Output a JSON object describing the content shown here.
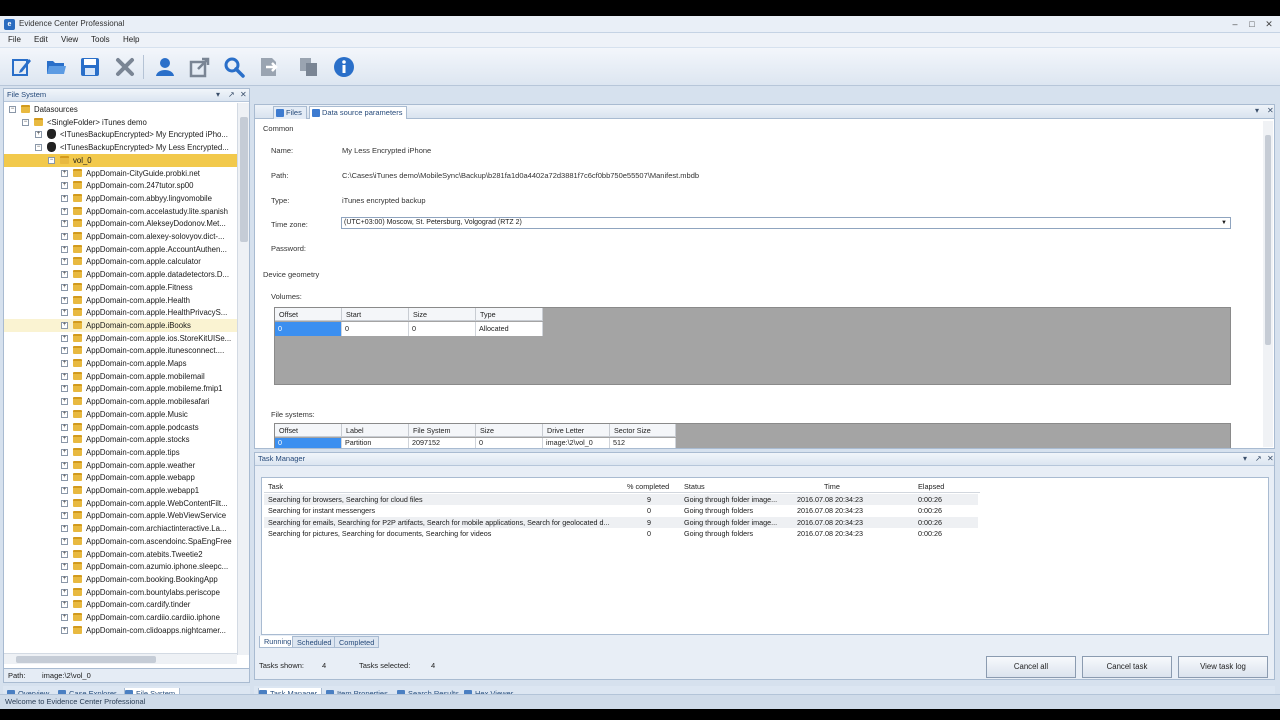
{
  "window": {
    "title": "Evidence Center Professional",
    "icon_letter": "e"
  },
  "menu": [
    "File",
    "Edit",
    "View",
    "Tools",
    "Help"
  ],
  "toolbar": [
    {
      "name": "edit-icon",
      "color": "#2a6fc9"
    },
    {
      "name": "open-folder-icon",
      "color": "#2a6fc9"
    },
    {
      "name": "save-icon",
      "color": "#2a6fc9"
    },
    {
      "name": "close-icon",
      "color": "#7a8594"
    },
    {
      "name": "user-icon",
      "color": "#2a6fc9"
    },
    {
      "name": "export-icon",
      "color": "#7a8594"
    },
    {
      "name": "search-icon",
      "color": "#2a6fc9"
    },
    {
      "name": "import-icon",
      "color": "#7a8594"
    },
    {
      "name": "copy-icon",
      "color": "#7a8594"
    },
    {
      "name": "info-icon",
      "color": "#2a6fc9"
    }
  ],
  "left_panel": {
    "title": "File System",
    "tree": [
      {
        "label": "Datasources",
        "indent": 0,
        "icon": "folder",
        "exp": "-"
      },
      {
        "label": "<SingleFolder> iTunes demo",
        "indent": 1,
        "icon": "folder",
        "exp": "-"
      },
      {
        "label": "<ITunesBackupEncrypted> My Encrypted iPho...",
        "indent": 2,
        "icon": "apple",
        "exp": "+"
      },
      {
        "label": "<ITunesBackupEncrypted> My Less Encrypted...",
        "indent": 2,
        "icon": "apple",
        "exp": "-"
      },
      {
        "label": "vol_0",
        "indent": 3,
        "icon": "folder",
        "exp": "-",
        "selected": true
      },
      {
        "label": "AppDomain-CityGuide.probki.net",
        "indent": 4,
        "icon": "folder",
        "exp": "+"
      },
      {
        "label": "AppDomain-com.247tutor.sp00",
        "indent": 4,
        "icon": "folder",
        "exp": "+"
      },
      {
        "label": "AppDomain-com.abbyy.lingvomobile",
        "indent": 4,
        "icon": "folder",
        "exp": "+"
      },
      {
        "label": "AppDomain-com.accelastudy.lite.spanish",
        "indent": 4,
        "icon": "folder",
        "exp": "+"
      },
      {
        "label": "AppDomain-com.AlekseyDodonov.Met...",
        "indent": 4,
        "icon": "folder",
        "exp": "+"
      },
      {
        "label": "AppDomain-com.alexey-solovyov.dict-...",
        "indent": 4,
        "icon": "folder",
        "exp": "+"
      },
      {
        "label": "AppDomain-com.apple.AccountAuthen...",
        "indent": 4,
        "icon": "folder",
        "exp": "+"
      },
      {
        "label": "AppDomain-com.apple.calculator",
        "indent": 4,
        "icon": "folder",
        "exp": "+"
      },
      {
        "label": "AppDomain-com.apple.datadetectors.D...",
        "indent": 4,
        "icon": "folder",
        "exp": "+"
      },
      {
        "label": "AppDomain-com.apple.Fitness",
        "indent": 4,
        "icon": "folder",
        "exp": "+"
      },
      {
        "label": "AppDomain-com.apple.Health",
        "indent": 4,
        "icon": "folder",
        "exp": "+"
      },
      {
        "label": "AppDomain-com.apple.HealthPrivacyS...",
        "indent": 4,
        "icon": "folder",
        "exp": "+"
      },
      {
        "label": "AppDomain-com.apple.iBooks",
        "indent": 4,
        "icon": "folder",
        "exp": "+",
        "hover": true
      },
      {
        "label": "AppDomain-com.apple.ios.StoreKitUISe...",
        "indent": 4,
        "icon": "folder",
        "exp": "+"
      },
      {
        "label": "AppDomain-com.apple.itunesconnect....",
        "indent": 4,
        "icon": "folder",
        "exp": "+"
      },
      {
        "label": "AppDomain-com.apple.Maps",
        "indent": 4,
        "icon": "folder",
        "exp": "+"
      },
      {
        "label": "AppDomain-com.apple.mobilemail",
        "indent": 4,
        "icon": "folder",
        "exp": "+"
      },
      {
        "label": "AppDomain-com.apple.mobileme.fmip1",
        "indent": 4,
        "icon": "folder",
        "exp": "+"
      },
      {
        "label": "AppDomain-com.apple.mobilesafari",
        "indent": 4,
        "icon": "folder",
        "exp": "+"
      },
      {
        "label": "AppDomain-com.apple.Music",
        "indent": 4,
        "icon": "folder",
        "exp": "+"
      },
      {
        "label": "AppDomain-com.apple.podcasts",
        "indent": 4,
        "icon": "folder",
        "exp": "+"
      },
      {
        "label": "AppDomain-com.apple.stocks",
        "indent": 4,
        "icon": "folder",
        "exp": "+"
      },
      {
        "label": "AppDomain-com.apple.tips",
        "indent": 4,
        "icon": "folder",
        "exp": "+"
      },
      {
        "label": "AppDomain-com.apple.weather",
        "indent": 4,
        "icon": "folder",
        "exp": "+"
      },
      {
        "label": "AppDomain-com.apple.webapp",
        "indent": 4,
        "icon": "folder",
        "exp": "+"
      },
      {
        "label": "AppDomain-com.apple.webapp1",
        "indent": 4,
        "icon": "folder",
        "exp": "+"
      },
      {
        "label": "AppDomain-com.apple.WebContentFilt...",
        "indent": 4,
        "icon": "folder",
        "exp": "+"
      },
      {
        "label": "AppDomain-com.apple.WebViewService",
        "indent": 4,
        "icon": "folder",
        "exp": "+"
      },
      {
        "label": "AppDomain-com.archiactinteractive.La...",
        "indent": 4,
        "icon": "folder",
        "exp": "+"
      },
      {
        "label": "AppDomain-com.ascendoinc.SpaEngFree",
        "indent": 4,
        "icon": "folder",
        "exp": "+"
      },
      {
        "label": "AppDomain-com.atebits.Tweetie2",
        "indent": 4,
        "icon": "folder",
        "exp": "+"
      },
      {
        "label": "AppDomain-com.azumio.iphone.sleepc...",
        "indent": 4,
        "icon": "folder",
        "exp": "+"
      },
      {
        "label": "AppDomain-com.booking.BookingApp",
        "indent": 4,
        "icon": "folder",
        "exp": "+"
      },
      {
        "label": "AppDomain-com.bountylabs.periscope",
        "indent": 4,
        "icon": "folder",
        "exp": "+"
      },
      {
        "label": "AppDomain-com.cardify.tinder",
        "indent": 4,
        "icon": "folder",
        "exp": "+"
      },
      {
        "label": "AppDomain-com.cardiio.cardiio.iphone",
        "indent": 4,
        "icon": "folder",
        "exp": "+"
      },
      {
        "label": "AppDomain-com.clidoapps.nightcamer...",
        "indent": 4,
        "icon": "folder",
        "exp": "+"
      }
    ],
    "path_label": "Path:",
    "path_value": "image:\\2\\vol_0",
    "tabs": [
      {
        "label": "Overview",
        "active": false
      },
      {
        "label": "Case Explorer",
        "active": false
      },
      {
        "label": "File System",
        "active": true
      }
    ]
  },
  "doc_tabs": [
    {
      "label": "Files",
      "active": false
    },
    {
      "label": "Data source parameters",
      "active": true
    }
  ],
  "params": {
    "common_label": "Common",
    "name_label": "Name:",
    "name_value": "My Less Encrypted iPhone",
    "path_label": "Path:",
    "path_value": "C:\\Cases\\iTunes demo\\MobileSync\\Backup\\b281fa1d0a4402a72d3881f7c6cf0bb750e55507\\Manifest.mbdb",
    "type_label": "Type:",
    "type_value": "iTunes encrypted backup",
    "timezone_label": "Time zone:",
    "timezone_value": "(UTC+03:00) Moscow, St. Petersburg, Volgograd (RTZ 2)",
    "password_label": "Password:",
    "geometry_label": "Device geometry",
    "volumes_label": "Volumes:",
    "volumes": {
      "columns": [
        "Offset",
        "Start",
        "Size",
        "Type"
      ],
      "rows": [
        [
          "0",
          "0",
          "0",
          "Allocated"
        ]
      ]
    },
    "filesystems_label": "File systems:",
    "filesystems": {
      "columns": [
        "Offset",
        "Label",
        "File System",
        "Size",
        "Drive Letter",
        "Sector Size"
      ],
      "rows": [
        [
          "0",
          "Partition",
          "2097152",
          "0",
          "image:\\2\\vol_0",
          "512"
        ]
      ]
    }
  },
  "task_manager": {
    "title": "Task Manager",
    "columns": [
      "Task",
      "% completed",
      "Status",
      "Time",
      "Elapsed"
    ],
    "rows": [
      [
        "Searching for browsers, Searching for cloud files",
        "9",
        "Going through folder image...",
        "2016.07.08 20:34:23",
        "0:00:26"
      ],
      [
        "Searching for instant messengers",
        "0",
        "Going through folders",
        "2016.07.08 20:34:23",
        "0:00:26"
      ],
      [
        "Searching for emails, Searching for P2P artifacts, Search for mobile applications, Search for geolocated d...",
        "9",
        "Going through folder image...",
        "2016.07.08 20:34:23",
        "0:00:26"
      ],
      [
        "Searching for pictures, Searching for documents, Searching for videos",
        "0",
        "Going through folders",
        "2016.07.08 20:34:23",
        "0:00:26"
      ]
    ],
    "tabs": [
      {
        "label": "Running",
        "active": true
      },
      {
        "label": "Scheduled",
        "active": false
      },
      {
        "label": "Completed",
        "active": false
      }
    ],
    "shown_label": "Tasks shown:",
    "shown_value": "4",
    "selected_label": "Tasks selected:",
    "selected_value": "4",
    "buttons": [
      "Cancel all",
      "Cancel task",
      "View task log"
    ]
  },
  "bottom_tabs": [
    {
      "label": "Task Manager",
      "active": true
    },
    {
      "label": "Item Properties",
      "active": false
    },
    {
      "label": "Search Results",
      "active": false
    },
    {
      "label": "Hex Viewer",
      "active": false
    }
  ],
  "status": "Welcome to Evidence Center Professional",
  "colors": {
    "accent": "#2a6fc9",
    "selection": "#f2c94c",
    "grid_selection": "#3b8ff0"
  }
}
